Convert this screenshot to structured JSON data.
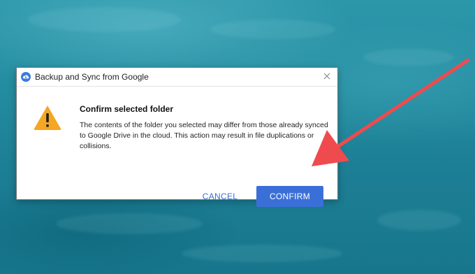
{
  "dialog": {
    "title": "Backup and Sync from Google",
    "app_icon": "google-backup-and-sync-cloud-icon",
    "close_icon": "close-icon",
    "warning_icon": "warning-triangle-icon",
    "heading": "Confirm selected folder",
    "message": "The contents of the folder you selected may differ from those already synced to Google Drive in the cloud. This action may result in file duplications or collisions.",
    "cancel_label": "CANCEL",
    "confirm_label": "CONFIRM"
  },
  "annotation": {
    "arrow_color": "#ef4b4e",
    "arrow_target": "confirm-button"
  },
  "colors": {
    "accent": "#3b6fd8",
    "warning": "#f5a623",
    "desktop": "#1f7f92"
  }
}
